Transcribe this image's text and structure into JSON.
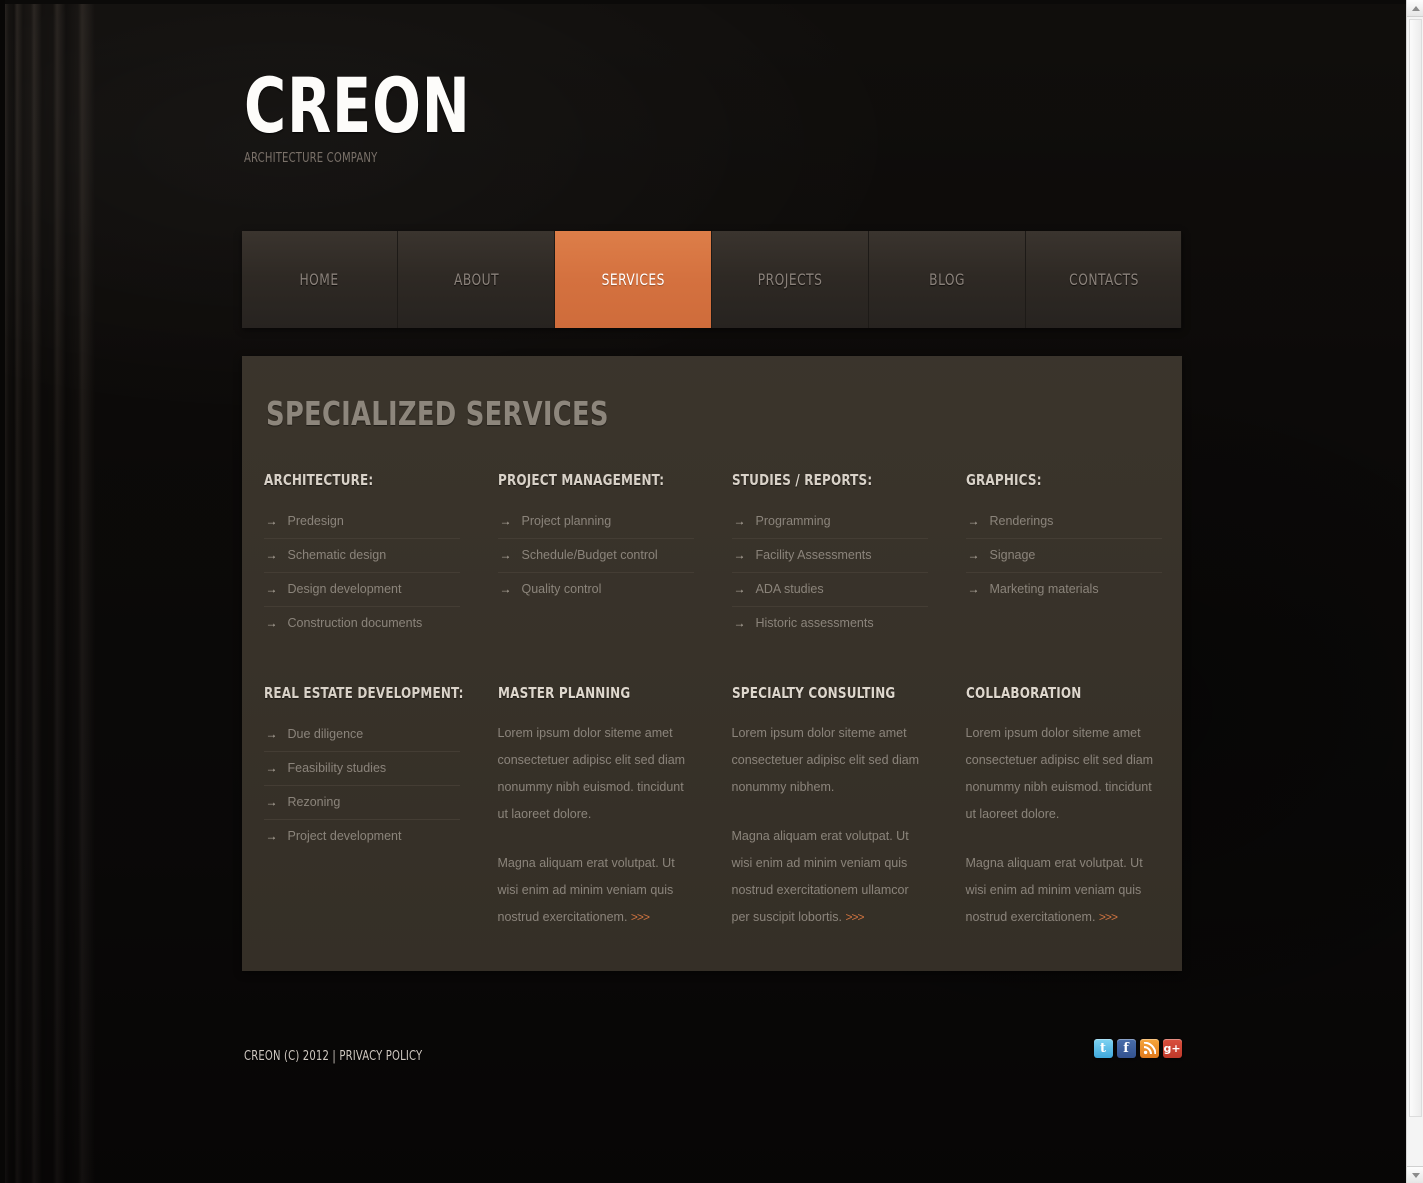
{
  "site": {
    "logo": "CREON",
    "tagline": "ARCHITECTURE COMPANY"
  },
  "nav": {
    "items": [
      {
        "label": "HOME",
        "active": false
      },
      {
        "label": "ABOUT",
        "active": false
      },
      {
        "label": "SERVICES",
        "active": true
      },
      {
        "label": "PROJECTS",
        "active": false
      },
      {
        "label": "BLOG",
        "active": false
      },
      {
        "label": "CONTACTS",
        "active": false
      }
    ],
    "active_color": "#d4713f"
  },
  "main": {
    "title": "SPECIALIZED SERVICES",
    "row1": [
      {
        "heading": "ARCHITECTURE:",
        "items": [
          "Predesign",
          "Schematic design",
          "Design development",
          "Construction documents"
        ]
      },
      {
        "heading": "PROJECT MANAGEMENT:",
        "items": [
          "Project planning",
          "Schedule/Budget control",
          "Quality control"
        ]
      },
      {
        "heading": "STUDIES / REPORTS:",
        "items": [
          "Programming",
          "Facility Assessments",
          "ADA studies",
          "Historic assessments"
        ]
      },
      {
        "heading": "GRAPHICS:",
        "items": [
          "Renderings",
          "Signage",
          "Marketing materials"
        ]
      }
    ],
    "row2_list": {
      "heading": "REAL ESTATE DEVELOPMENT:",
      "items": [
        "Due diligence",
        "Feasibility studies",
        "Rezoning",
        "Project development"
      ]
    },
    "row2_blocks": [
      {
        "heading": "MASTER PLANNING",
        "para1": "Lorem ipsum dolor siteme amet consectetuer adipisc elit sed diam nonummy nibh euismod.  tincidunt ut laoreet dolore.",
        "para2": "Magna aliquam erat volutpat. Ut wisi enim ad minim veniam quis nostrud exercitationem.",
        "more": ">>>"
      },
      {
        "heading": "SPECIALTY CONSULTING",
        "para1": "Lorem ipsum dolor siteme amet consectetuer adipisc elit sed diam nonummy nibhem.",
        "para2": "Magna aliquam erat volutpat. Ut wisi enim ad minim veniam quis nostrud exercitationem ullamcor per suscipit lobortis.",
        "more": ">>>"
      },
      {
        "heading": "COLLABORATION",
        "para1": "Lorem ipsum dolor siteme amet consectetuer adipisc elit sed diam nonummy nibh euismod.  tincidunt ut laoreet dolore.",
        "para2": "Magna aliquam erat volutpat. Ut wisi enim ad minim veniam quis nostrud exercitationem.",
        "more": ">>>"
      }
    ],
    "arrow_marker": "→"
  },
  "footer": {
    "copyright": "CREON (C) 2012 | PRIVACY POLICY",
    "social": [
      {
        "name": "twitter-icon",
        "label": "t",
        "color": "#3fa9dd"
      },
      {
        "name": "facebook-icon",
        "label": "f",
        "color": "#33528f"
      },
      {
        "name": "rss-icon",
        "label": "",
        "color": "#e07a1d"
      },
      {
        "name": "gplus-icon",
        "label": "g+",
        "color": "#c0392b"
      }
    ]
  }
}
